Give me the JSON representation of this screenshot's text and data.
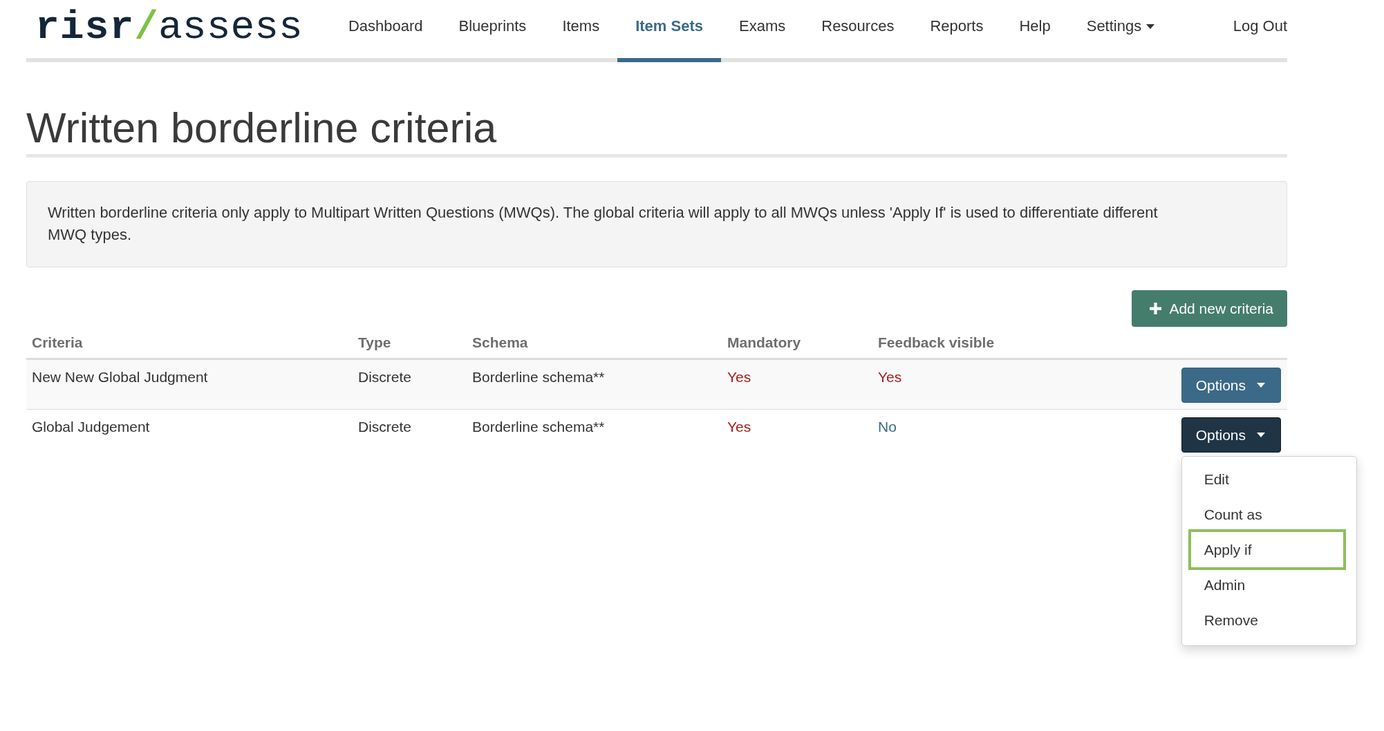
{
  "header": {
    "logo": {
      "word_1": "risr",
      "divider": "/",
      "word_2": "assess"
    },
    "nav": [
      {
        "label": "Dashboard",
        "selected": false,
        "has_menu": false
      },
      {
        "label": "Blueprints",
        "selected": false,
        "has_menu": false
      },
      {
        "label": "Items",
        "selected": false,
        "has_menu": false
      },
      {
        "label": "Item Sets",
        "selected": true,
        "has_menu": false
      },
      {
        "label": "Exams",
        "selected": false,
        "has_menu": false
      },
      {
        "label": "Resources",
        "selected": false,
        "has_menu": false
      },
      {
        "label": "Reports",
        "selected": false,
        "has_menu": false
      },
      {
        "label": "Help",
        "selected": false,
        "has_menu": false
      },
      {
        "label": "Settings",
        "selected": false,
        "has_menu": true
      }
    ],
    "logout": "Log Out"
  },
  "page_title": "Written borderline criteria",
  "info_box": {
    "text": "Written borderline criteria only apply to Multipart Written Questions (MWQs). The global criteria will apply to all MWQs unless 'Apply If' is used to differentiate different MWQ types."
  },
  "add_button": {
    "label": "Add new criteria"
  },
  "table": {
    "columns": [
      "Criteria",
      "Type",
      "Schema",
      "Mandatory",
      "Feedback visible"
    ],
    "rows": [
      {
        "criteria": "New New Global Judgment",
        "type": "Discrete",
        "schema": "Borderline schema**",
        "mandatory": {
          "text": "Yes",
          "on": true
        },
        "feedback_visible": {
          "text": "Yes",
          "on": true
        },
        "options_button": {
          "label": "Options",
          "expanded": false
        }
      },
      {
        "criteria": "Global Judgement",
        "type": "Discrete",
        "schema": "Borderline schema**",
        "mandatory": {
          "text": "Yes",
          "on": true
        },
        "feedback_visible": {
          "text": "No",
          "on": false
        },
        "options_button": {
          "label": "Options",
          "expanded": true,
          "menu": [
            {
              "label": "Edit",
              "highlighted": false
            },
            {
              "label": "Count as",
              "highlighted": false
            },
            {
              "label": "Apply if",
              "highlighted": true
            },
            {
              "label": "Admin",
              "highlighted": false
            },
            {
              "label": "Remove",
              "highlighted": false
            }
          ]
        }
      }
    ]
  }
}
